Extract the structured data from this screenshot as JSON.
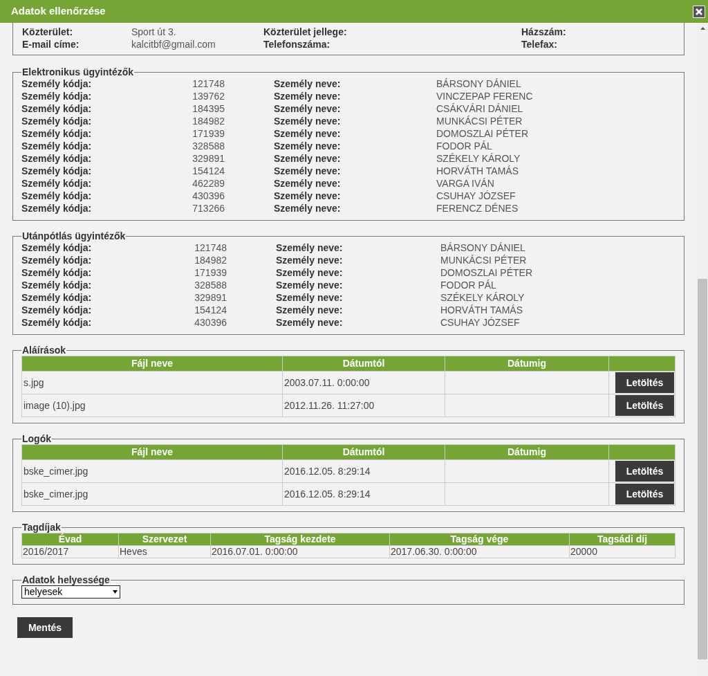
{
  "window": {
    "title": "Adatok ellenőrzése"
  },
  "address": {
    "rows": [
      [
        {
          "label": "Közterület:",
          "value": "Sport út 3."
        },
        {
          "label": "Közterület jellege:"
        },
        {
          "label": "Házszám:"
        }
      ],
      [
        {
          "label": "E-mail címe:",
          "value": "kalcitbf@gmail.com"
        },
        {
          "label": "Telefonszáma:"
        },
        {
          "label": "Telefax:"
        }
      ]
    ]
  },
  "person_sections": [
    {
      "title": "Elektronikus ügyintézők",
      "rows": [
        {
          "code_label": "Személy kódja:",
          "code": "121748",
          "name_label": "Személy neve:",
          "name": "BÁRSONY DÁNIEL"
        },
        {
          "code_label": "Személy kódja:",
          "code": "139762",
          "name_label": "Személy neve:",
          "name": "VINCZEPAP FERENC"
        },
        {
          "code_label": "Személy kódja:",
          "code": "184395",
          "name_label": "Személy neve:",
          "name": "CSÁKVÁRI DÁNIEL"
        },
        {
          "code_label": "Személy kódja:",
          "code": "184982",
          "name_label": "Személy neve:",
          "name": "MUNKÁCSI PÉTER"
        },
        {
          "code_label": "Személy kódja:",
          "code": "171939",
          "name_label": "Személy neve:",
          "name": "DOMOSZLAI PÉTER"
        },
        {
          "code_label": "Személy kódja:",
          "code": "328588",
          "name_label": "Személy neve:",
          "name": "FODOR PÁL"
        },
        {
          "code_label": "Személy kódja:",
          "code": "329891",
          "name_label": "Személy neve:",
          "name": "SZÉKELY KÁROLY"
        },
        {
          "code_label": "Személy kódja:",
          "code": "154124",
          "name_label": "Személy neve:",
          "name": "HORVÁTH TAMÁS"
        },
        {
          "code_label": "Személy kódja:",
          "code": "462289",
          "name_label": "Személy neve:",
          "name": "VARGA IVÁN"
        },
        {
          "code_label": "Személy kódja:",
          "code": "430396",
          "name_label": "Személy neve:",
          "name": "CSUHAY JÓZSEF"
        },
        {
          "code_label": "Személy kódja:",
          "code": "713266",
          "name_label": "Személy neve:",
          "name": "FERENCZ DÉNES"
        }
      ]
    },
    {
      "title": "Utánpótlás ügyintézők",
      "rows": [
        {
          "code_label": "Személy kódja:",
          "code": "121748",
          "name_label": "Személy neve:",
          "name": "BÁRSONY DÁNIEL"
        },
        {
          "code_label": "Személy kódja:",
          "code": "184982",
          "name_label": "Személy neve:",
          "name": "MUNKÁCSI PÉTER"
        },
        {
          "code_label": "Személy kódja:",
          "code": "171939",
          "name_label": "Személy neve:",
          "name": "DOMOSZLAI PÉTER"
        },
        {
          "code_label": "Személy kódja:",
          "code": "328588",
          "name_label": "Személy neve:",
          "name": "FODOR PÁL"
        },
        {
          "code_label": "Személy kódja:",
          "code": "329891",
          "name_label": "Személy neve:",
          "name": "SZÉKELY KÁROLY"
        },
        {
          "code_label": "Személy kódja:",
          "code": "154124",
          "name_label": "Személy neve:",
          "name": "HORVÁTH TAMÁS"
        },
        {
          "code_label": "Személy kódja:",
          "code": "430396",
          "name_label": "Személy neve:",
          "name": "CSUHAY JÓZSEF"
        }
      ]
    }
  ],
  "file_sections": [
    {
      "title": "Aláírások",
      "columns": [
        "Fájl neve",
        "Dátumtól",
        "Dátumig"
      ],
      "rows": [
        {
          "file": "s.jpg",
          "from": "2003.07.11. 0:00:00",
          "button": "Letöltés"
        },
        {
          "file": "image (10).jpg",
          "from": "2012.11.26. 11:27:00",
          "button": "Letöltés"
        }
      ]
    },
    {
      "title": "Logók",
      "columns": [
        "Fájl neve",
        "Dátumtól",
        "Dátumig"
      ],
      "rows": [
        {
          "file": "bske_cimer.jpg",
          "from": "2016.12.05. 8:29:14",
          "button": "Letöltés"
        },
        {
          "file": "bske_cimer.jpg",
          "from": "2016.12.05. 8:29:14",
          "button": "Letöltés"
        }
      ]
    }
  ],
  "fees": {
    "title": "Tagdíjak",
    "columns": [
      "Évad",
      "Szervezet",
      "Tagság kezdete",
      "Tagság vége",
      "Tagsádi díj"
    ],
    "rows": [
      [
        "2016/2017",
        "Heves",
        "2016.07.01. 0:00:00",
        "2017.06.30. 0:00:00",
        "20000"
      ]
    ]
  },
  "validity": {
    "title": "Adatok helyessége",
    "value": "helyesek"
  },
  "save_button": "Mentés"
}
